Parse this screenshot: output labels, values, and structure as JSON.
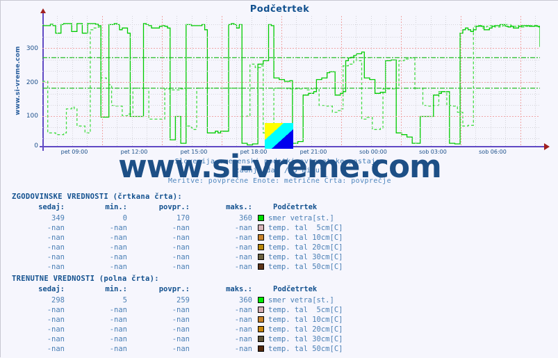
{
  "header": {
    "title": "Podčetrtek"
  },
  "sidebar_label": "www.si-vreme.com",
  "watermark": "www.si-vreme.com",
  "subtitle": {
    "line1": "Slovenija  vremenski podatki  avtomatske postaje:",
    "line2": "zadnji dan / 5 minut",
    "line3": "Meritve: povprečne  Enote: metrične  Črta: povprečje"
  },
  "axis": {
    "y_ticks": [
      "300",
      "200",
      "100",
      "0"
    ],
    "x_ticks": [
      "pet 09:00",
      "pet 12:00",
      "pet 15:00",
      "pet 18:00",
      "pet 21:00",
      "sob 00:00",
      "sob 03:00",
      "sob 06:00"
    ]
  },
  "tables": {
    "historical": {
      "caption": "ZGODOVINSKE VREDNOSTI (črtkana črta):",
      "headers": [
        "sedaj:",
        "min.:",
        "povpr.:",
        "maks.:",
        "Podčetrtek"
      ],
      "rows": [
        {
          "sedaj": "349",
          "min": "0",
          "povpr": "170",
          "maks": "360",
          "color": "#00dd00",
          "series": "smer vetra[st.]"
        },
        {
          "sedaj": "-nan",
          "min": "-nan",
          "povpr": "-nan",
          "maks": "-nan",
          "color": "#d6b3b8",
          "series": "temp. tal  5cm[C]"
        },
        {
          "sedaj": "-nan",
          "min": "-nan",
          "povpr": "-nan",
          "maks": "-nan",
          "color": "#c8822a",
          "series": "temp. tal 10cm[C]"
        },
        {
          "sedaj": "-nan",
          "min": "-nan",
          "povpr": "-nan",
          "maks": "-nan",
          "color": "#b8860b",
          "series": "temp. tal 20cm[C]"
        },
        {
          "sedaj": "-nan",
          "min": "-nan",
          "povpr": "-nan",
          "maks": "-nan",
          "color": "#6b6140",
          "series": "temp. tal 30cm[C]"
        },
        {
          "sedaj": "-nan",
          "min": "-nan",
          "povpr": "-nan",
          "maks": "-nan",
          "color": "#5c3317",
          "series": "temp. tal 50cm[C]"
        }
      ]
    },
    "current": {
      "caption": "TRENUTNE VREDNOSTI (polna črta):",
      "headers": [
        "sedaj:",
        "min.:",
        "povpr.:",
        "maks.:",
        "Podčetrtek"
      ],
      "rows": [
        {
          "sedaj": "298",
          "min": "5",
          "povpr": "259",
          "maks": "360",
          "color": "#00ee00",
          "series": "smer vetra[st.]"
        },
        {
          "sedaj": "-nan",
          "min": "-nan",
          "povpr": "-nan",
          "maks": "-nan",
          "color": "#d6aeb4",
          "series": "temp. tal  5cm[C]"
        },
        {
          "sedaj": "-nan",
          "min": "-nan",
          "povpr": "-nan",
          "maks": "-nan",
          "color": "#c8822a",
          "series": "temp. tal 10cm[C]"
        },
        {
          "sedaj": "-nan",
          "min": "-nan",
          "povpr": "-nan",
          "maks": "-nan",
          "color": "#c8860b",
          "series": "temp. tal 20cm[C]"
        },
        {
          "sedaj": "-nan",
          "min": "-nan",
          "povpr": "-nan",
          "maks": "-nan",
          "color": "#5d5338",
          "series": "temp. tal 30cm[C]"
        },
        {
          "sedaj": "-nan",
          "min": "-nan",
          "povpr": "-nan",
          "maks": "-nan",
          "color": "#53290d",
          "series": "temp. tal 50cm[C]"
        }
      ]
    }
  },
  "chart_data": {
    "type": "line",
    "title": "Podčetrtek",
    "xlabel": "",
    "ylabel": "smer vetra [st.]",
    "ylim": [
      0,
      380
    ],
    "grid": true,
    "legend": "below",
    "avg_lines": [
      {
        "name": "povprečje zgodovinske",
        "value": 170,
        "style": "dash-dot",
        "color": "#22bb22"
      },
      {
        "name": "povprečje trenutne",
        "value": 259,
        "style": "dash-dot",
        "color": "#22bb22"
      }
    ],
    "x": [
      "pet 09:00",
      "pet 12:00",
      "pet 15:00",
      "pet 18:00",
      "pet 21:00",
      "sob 00:00",
      "sob 03:00",
      "sob 06:00"
    ],
    "series": [
      {
        "name": "smer vetra[st.] (trenutne / polna črta)",
        "color": "#00cc00",
        "style": "solid",
        "values": [
          352,
          352,
          352,
          356,
          352,
          330,
          330,
          355,
          358,
          358,
          358,
          335,
          335,
          358,
          358,
          330,
          330,
          358,
          358,
          358,
          356,
          352,
          86,
          86,
          86,
          355,
          355,
          358,
          355,
          340,
          345,
          345,
          330,
          88,
          88,
          88,
          88,
          88,
          358,
          355,
          352,
          345,
          345,
          345,
          350,
          352,
          350,
          345,
          20,
          20,
          88,
          88,
          10,
          10,
          355,
          355,
          352,
          352,
          352,
          352,
          355,
          340,
          40,
          40,
          40,
          45,
          40,
          45,
          45,
          45,
          355,
          358,
          355,
          345,
          355,
          10,
          10,
          5,
          5,
          8,
          8,
          240,
          240,
          250,
          250,
          355,
          352,
          200,
          200,
          195,
          195,
          190,
          190,
          192,
          10,
          10,
          15,
          15,
          150,
          150,
          155,
          155,
          160,
          195,
          195,
          200,
          200,
          215,
          218,
          218,
          150,
          150,
          155,
          160,
          250,
          258,
          260,
          265,
          270,
          270,
          275,
          200,
          200,
          195,
          195,
          155,
          155,
          158,
          158,
          250,
          250,
          252,
          252,
          40,
          40,
          35,
          35,
          28,
          28,
          10,
          10,
          10,
          88,
          88,
          88,
          88,
          88,
          150,
          150,
          155,
          160,
          160,
          160,
          10,
          10,
          8,
          8,
          330,
          340,
          345,
          340,
          335,
          340,
          350,
          352,
          350,
          340,
          340,
          345,
          350,
          352,
          352,
          355,
          355,
          350,
          348,
          350,
          345,
          345,
          350,
          352,
          352,
          352,
          350,
          350,
          352,
          350,
          290
        ]
      },
      {
        "name": "smer vetra[st.] (zgodovinske / črtkana črta)",
        "color": "#44dd44",
        "style": "dashed",
        "values": [
          190,
          190,
          40,
          40,
          40,
          35,
          35,
          35,
          40,
          110,
          110,
          115,
          110,
          60,
          60,
          60,
          40,
          40,
          340,
          345,
          345,
          348,
          200,
          200,
          198,
          180,
          120,
          118,
          118,
          118,
          90,
          90,
          95,
          95,
          170,
          170,
          170,
          170,
          170,
          170,
          80,
          80,
          80,
          80,
          80,
          80,
          168,
          168,
          165,
          165,
          165,
          165,
          168,
          168,
          60,
          60,
          55,
          50,
          170,
          170,
          170,
          170,
          170,
          170,
          170,
          170,
          170,
          170,
          170,
          170,
          170,
          170,
          170,
          170,
          170,
          88,
          88,
          90,
          240,
          240,
          230,
          230,
          235,
          40,
          40,
          45,
          45,
          170,
          170,
          170,
          170,
          170,
          168,
          168,
          168,
          168,
          168,
          168,
          170,
          165,
          165,
          168,
          168,
          170,
          120,
          120,
          118,
          118,
          118,
          100,
          100,
          105,
          110,
          235,
          235,
          240,
          240,
          260,
          250,
          250,
          80,
          80,
          85,
          85,
          50,
          50,
          50,
          55,
          168,
          168,
          168,
          168,
          168,
          170,
          250,
          250,
          255,
          255,
          258,
          258,
          168,
          170,
          170,
          120,
          120,
          118,
          118,
          120,
          120,
          160,
          160,
          160,
          120,
          120,
          118,
          118,
          100,
          100,
          60,
          60,
          62,
          62,
          350,
          350,
          350,
          345,
          348,
          350,
          352,
          352,
          348,
          348,
          350,
          352,
          355,
          355,
          352,
          350,
          352,
          350,
          348,
          350,
          350,
          352,
          350,
          350,
          348,
          349
        ]
      }
    ],
    "summary": {
      "historical": {
        "sedaj": 349,
        "min": 0,
        "povpr": 170,
        "maks": 360
      },
      "current": {
        "sedaj": 298,
        "min": 5,
        "povpr": 259,
        "maks": 360
      }
    }
  }
}
